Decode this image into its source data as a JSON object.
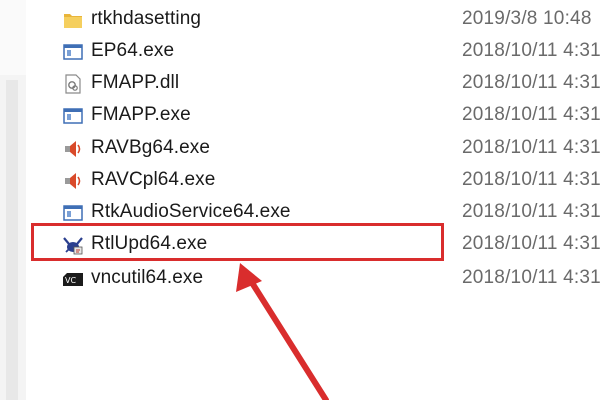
{
  "files": [
    {
      "name": "rtkhdasetting",
      "modified": "2019/3/8 10:48",
      "icon": "folder-icon"
    },
    {
      "name": "EP64.exe",
      "modified": "2018/10/11 4:31",
      "icon": "window-app-icon"
    },
    {
      "name": "FMAPP.dll",
      "modified": "2018/10/11 4:31",
      "icon": "dll-file-icon"
    },
    {
      "name": "FMAPP.exe",
      "modified": "2018/10/11 4:31",
      "icon": "window-app-icon"
    },
    {
      "name": "RAVBg64.exe",
      "modified": "2018/10/11 4:31",
      "icon": "speaker-icon"
    },
    {
      "name": "RAVCpl64.exe",
      "modified": "2018/10/11 4:31",
      "icon": "speaker-icon"
    },
    {
      "name": "RtkAudioService64.exe",
      "modified": "2018/10/11 4:31",
      "icon": "window-app-icon"
    },
    {
      "name": "RtlUpd64.exe",
      "modified": "2018/10/11 4:31",
      "icon": "realtek-crab-icon"
    },
    {
      "name": "vncutil64.exe",
      "modified": "2018/10/11 4:31",
      "icon": "vnc-icon"
    }
  ],
  "highlighted_file": "RtlUpd64.exe",
  "colors": {
    "annotation": "#d92d2d",
    "folder": "#f0c14b",
    "speaker": "#d94a2a"
  }
}
